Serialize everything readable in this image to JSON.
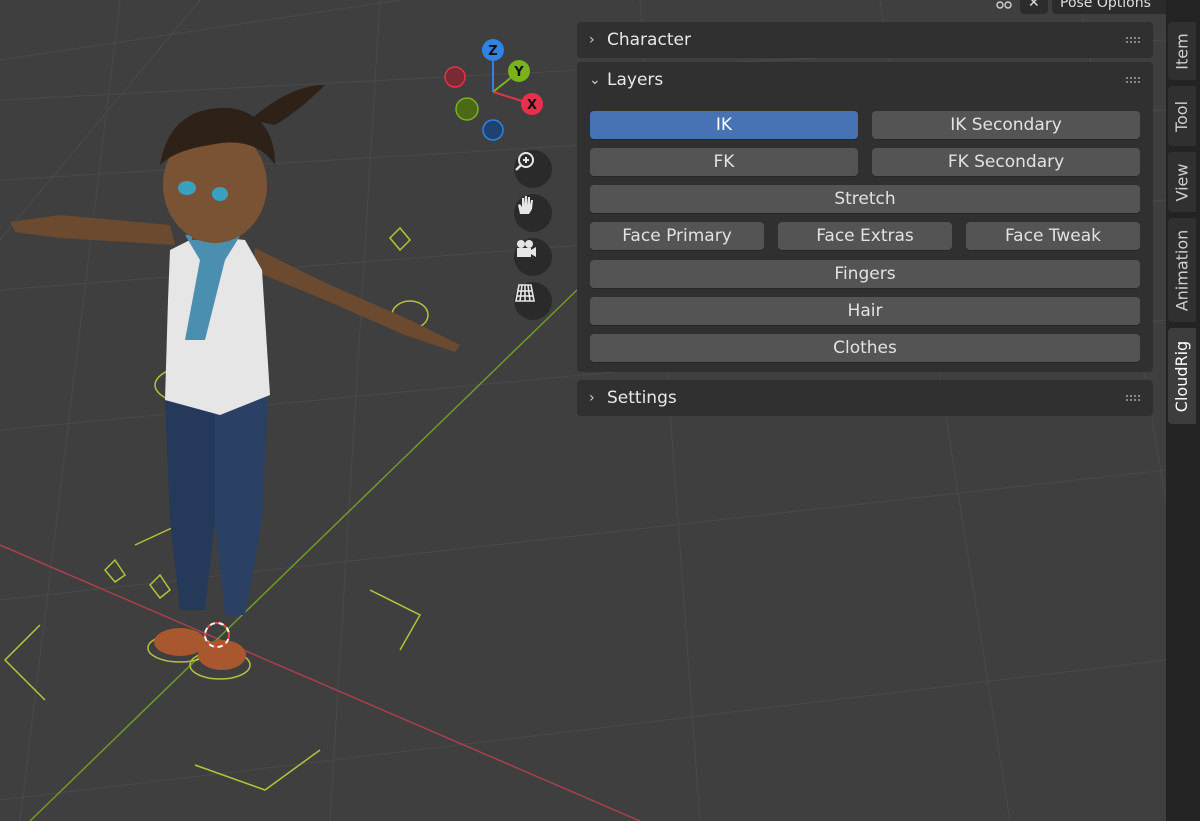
{
  "header": {
    "overlay_icon": "overlay-icon",
    "close_icon": "close-icon",
    "pose_options_label": "Pose Options"
  },
  "gizmo": {
    "z_label": "Z",
    "y_label": "Y",
    "x_label": "X",
    "colors": {
      "z": "#2f83e3",
      "y": "#79b21c",
      "x": "#e8304a"
    }
  },
  "nav_buttons": [
    "zoom-icon",
    "hand-pan-icon",
    "camera-icon",
    "grid-ortho-icon"
  ],
  "panels": {
    "character": {
      "title": "Character",
      "expanded": false
    },
    "layers": {
      "title": "Layers",
      "expanded": true,
      "buttons": {
        "ik": "IK",
        "ik_secondary": "IK Secondary",
        "fk": "FK",
        "fk_secondary": "FK Secondary",
        "stretch": "Stretch",
        "face_primary": "Face Primary",
        "face_extras": "Face Extras",
        "face_tweak": "Face Tweak",
        "fingers": "Fingers",
        "hair": "Hair",
        "clothes": "Clothes"
      },
      "active": "IK"
    },
    "settings": {
      "title": "Settings",
      "expanded": false
    }
  },
  "tabs": [
    "Item",
    "Tool",
    "View",
    "Animation",
    "CloudRig"
  ],
  "active_tab": "CloudRig",
  "colors": {
    "accent": "#4772b3",
    "panel": "#303030",
    "button": "#545454"
  }
}
